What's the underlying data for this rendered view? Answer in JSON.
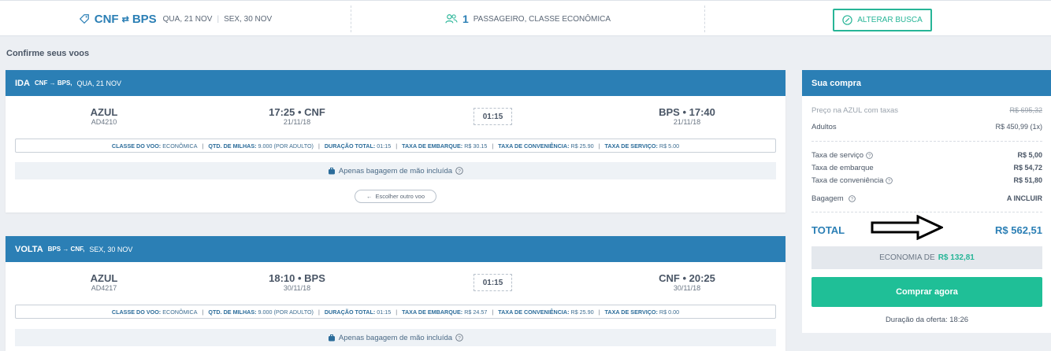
{
  "topbar": {
    "origin": "CNF",
    "destination": "BPS",
    "date_out": "QUA, 21 NOV",
    "date_back": "SEX, 30 NOV",
    "pax_count": "1",
    "pax_text": "PASSAGEIRO, CLASSE ECONÔMICA",
    "alter_label": "ALTERAR BUSCA"
  },
  "page_title": "Confirme seus voos",
  "outbound": {
    "dir": "IDA",
    "route": "CNF → BPS,",
    "date": "QUA, 21 NOV",
    "airline": "AZUL",
    "flight": "AD4210",
    "dep_time": "17:25 • CNF",
    "dep_date": "21/11/18",
    "duration": "01:15",
    "arr_time": "BPS • 17:40",
    "arr_date": "21/11/18",
    "details": {
      "class_label": "Classe do voo:",
      "class_value": "ECONÔMICA",
      "miles_label": "Qtd. de Milhas:",
      "miles_value": "9.000 (POR ADULTO)",
      "dur_label": "Duração total:",
      "dur_value": "01:15",
      "board_label": "Taxa de embarque:",
      "board_value": "R$ 30.15",
      "conv_label": "Taxa de conveniência:",
      "conv_value": "R$ 25.90",
      "serv_label": "Taxa de serviço:",
      "serv_value": "R$ 5.00"
    },
    "bag": "Apenas bagagem de mão incluída",
    "choose": "Escolher outro voo"
  },
  "inbound": {
    "dir": "VOLTA",
    "route": "BPS → CNF,",
    "date": "SEX, 30 NOV",
    "airline": "AZUL",
    "flight": "AD4217",
    "dep_time": "18:10 • BPS",
    "dep_date": "30/11/18",
    "duration": "01:15",
    "arr_time": "CNF • 20:25",
    "arr_date": "30/11/18",
    "details": {
      "class_label": "Classe do voo:",
      "class_value": "ECONÔMICA",
      "miles_label": "Qtd. de Milhas:",
      "miles_value": "9.000 (POR ADULTO)",
      "dur_label": "Duração total:",
      "dur_value": "01:15",
      "board_label": "Taxa de embarque:",
      "board_value": "R$ 24.57",
      "conv_label": "Taxa de conveniência:",
      "conv_value": "R$ 25.90",
      "serv_label": "Taxa de serviço:",
      "serv_value": "R$ 0.00"
    },
    "bag": "Apenas bagagem de mão incluída"
  },
  "summary": {
    "title": "Sua compra",
    "azul_label": "Preço na AZUL com taxas",
    "azul_value": "R$ 695,32",
    "adults_label": "Adultos",
    "adults_value": "R$ 450,99 (1x)",
    "serv_label": "Taxa de serviço",
    "serv_value": "R$ 5,00",
    "board_label": "Taxa de embarque",
    "board_value": "R$ 54,72",
    "conv_label": "Taxa de conveniência",
    "conv_value": "R$ 51,80",
    "bag_label": "Bagagem",
    "bag_value": "A INCLUIR",
    "total_label": "TOTAL",
    "total_value": "R$ 562,51",
    "econ_label": "ECONOMIA DE",
    "econ_value": "R$ 132,81",
    "buy_label": "Comprar agora",
    "offer": "Duração da oferta: 18:26"
  }
}
